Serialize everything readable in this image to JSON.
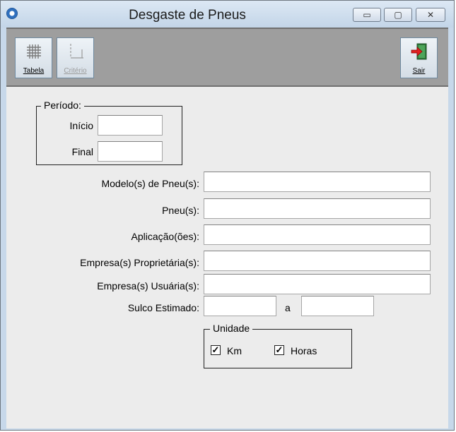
{
  "window": {
    "title": "Desgaste de Pneus"
  },
  "window_controls": {
    "minimize": "▭",
    "maximize": "▢",
    "close": "✕"
  },
  "toolbar": {
    "tabela_label": "Tabela",
    "criterio_label": "Critério",
    "sair_label": "Sair"
  },
  "form": {
    "periodo_legend": "Período:",
    "inicio_label": "Início",
    "final_label": "Final",
    "modelos_label": "Modelo(s) de Pneu(s):",
    "pneus_label": "Pneu(s):",
    "aplicacoes_label": "Aplicação(ões):",
    "empresa_proprietaria_label": "Empresa(s) Proprietária(s):",
    "empresa_usuaria_label": "Empresa(s) Usuária(s):",
    "sulco_label": "Sulco Estimado:",
    "sulco_separator": "a",
    "unidade_legend": "Unidade",
    "km_label": "Km",
    "horas_label": "Horas",
    "km_checked": true,
    "horas_checked": true,
    "inicio_value": "",
    "final_value": "",
    "modelos_value": "",
    "pneus_value": "",
    "aplicacoes_value": "",
    "empresa_proprietaria_value": "",
    "empresa_usuaria_value": "",
    "sulco_de_value": "",
    "sulco_ate_value": ""
  }
}
